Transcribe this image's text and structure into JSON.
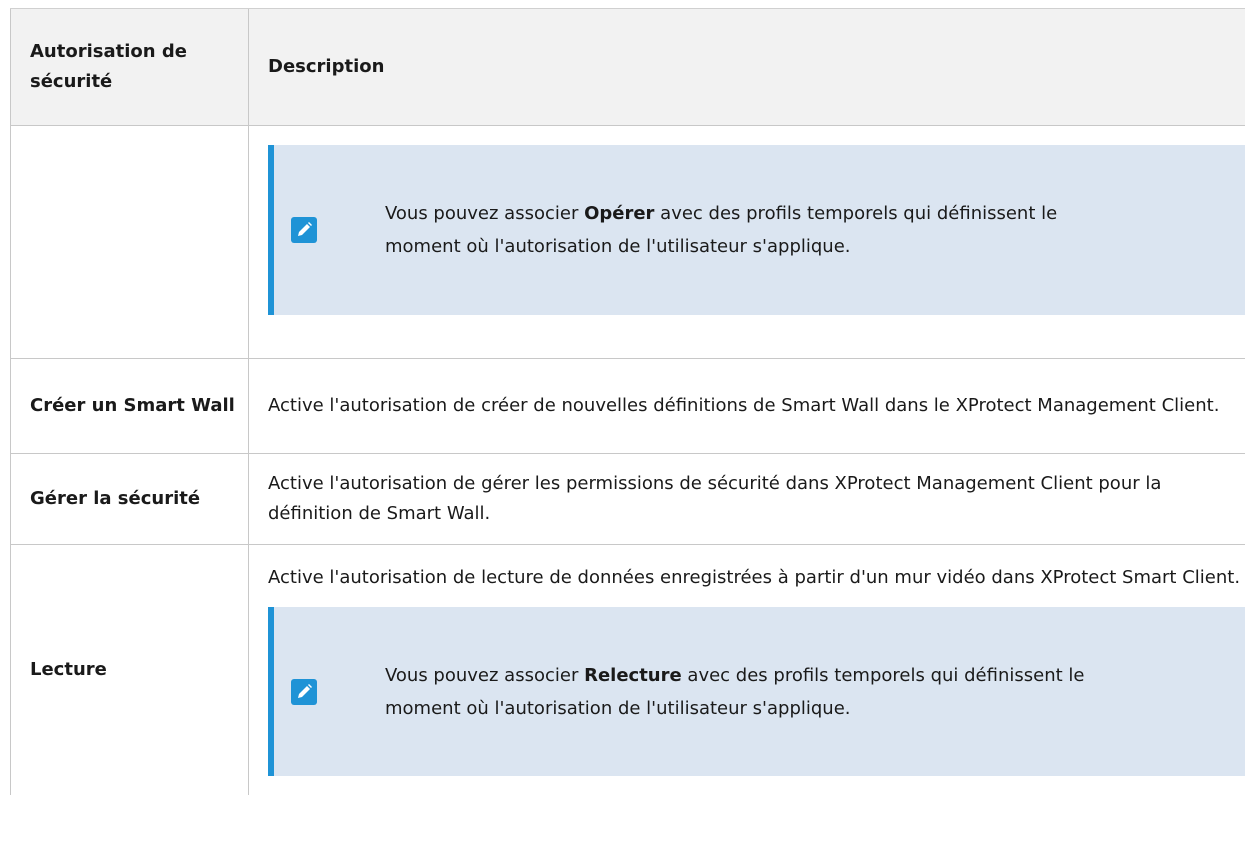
{
  "table": {
    "header": {
      "col1": "Autorisation de sécurité",
      "col2": "Description"
    },
    "rows": [
      {
        "name": "",
        "note": {
          "icon": "pencil-note-icon",
          "pre": "Vous pouvez associer ",
          "bold": "Opérer",
          "post": " avec des profils temporels qui définissent le moment où l'autorisation de l'utilisateur s'applique."
        }
      },
      {
        "name": "Créer un Smart Wall",
        "description": "Active l'autorisation de créer de nouvelles définitions de Smart Wall dans le XProtect Management Client."
      },
      {
        "name": "Gérer la sécurité",
        "description": "Active l'autorisation de gérer les permissions de sécurité dans XProtect Management Client pour la définition de Smart Wall."
      },
      {
        "name": "Lecture",
        "description": "Active l'autorisation de lecture de données enregistrées à partir d'un mur vidéo dans XProtect Smart Client.",
        "note": {
          "icon": "pencil-note-icon",
          "pre": "Vous pouvez associer ",
          "bold": "Relecture",
          "post": " avec des profils temporels qui définissent le moment où l'autorisation de l'utilisateur s'applique."
        }
      }
    ]
  },
  "colors": {
    "note_background": "#dbe5f1",
    "note_accent": "#1f93d6",
    "header_background": "#f2f2f2"
  }
}
